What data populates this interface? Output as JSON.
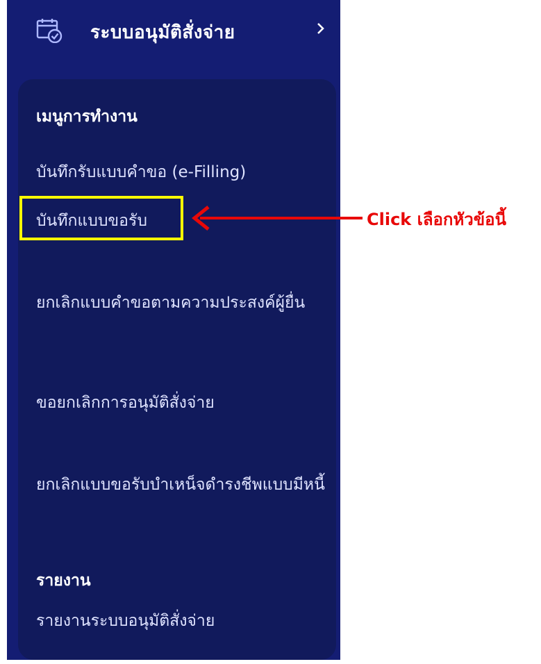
{
  "module": {
    "title": "ระบบอนุมัติสั่งจ่าย",
    "icon": "calendar-check-icon",
    "chevron_icon": "chevron-right-icon"
  },
  "submenu": {
    "sections": [
      {
        "heading": "เมนูการทำงาน",
        "items": [
          {
            "label": "บันทึกรับแบบคำขอ (e-Filling)"
          },
          {
            "label": "บันทึกแบบขอรับ",
            "highlighted": true
          },
          {
            "label": "ยกเลิกแบบคำขอตามความประสงค์ผู้ยื่น"
          },
          {
            "label": "ขอยกเลิกการอนุมัติสั่งจ่าย"
          },
          {
            "label": "ยกเลิกแบบขอรับบำเหน็จดำรงชีพแบบมีหนี้"
          }
        ]
      },
      {
        "heading": "รายงาน",
        "items": [
          {
            "label": "รายงานระบบอนุมัติสั่งจ่าย"
          }
        ]
      }
    ]
  },
  "annotation": {
    "text": "Click เลือกหัวข้อนี้",
    "color": "#e80808",
    "highlight_color": "#ffff00"
  },
  "colors": {
    "sidebar_bg": "#141d73",
    "submenu_bg": "#111a5c",
    "text": "#ffffff"
  }
}
